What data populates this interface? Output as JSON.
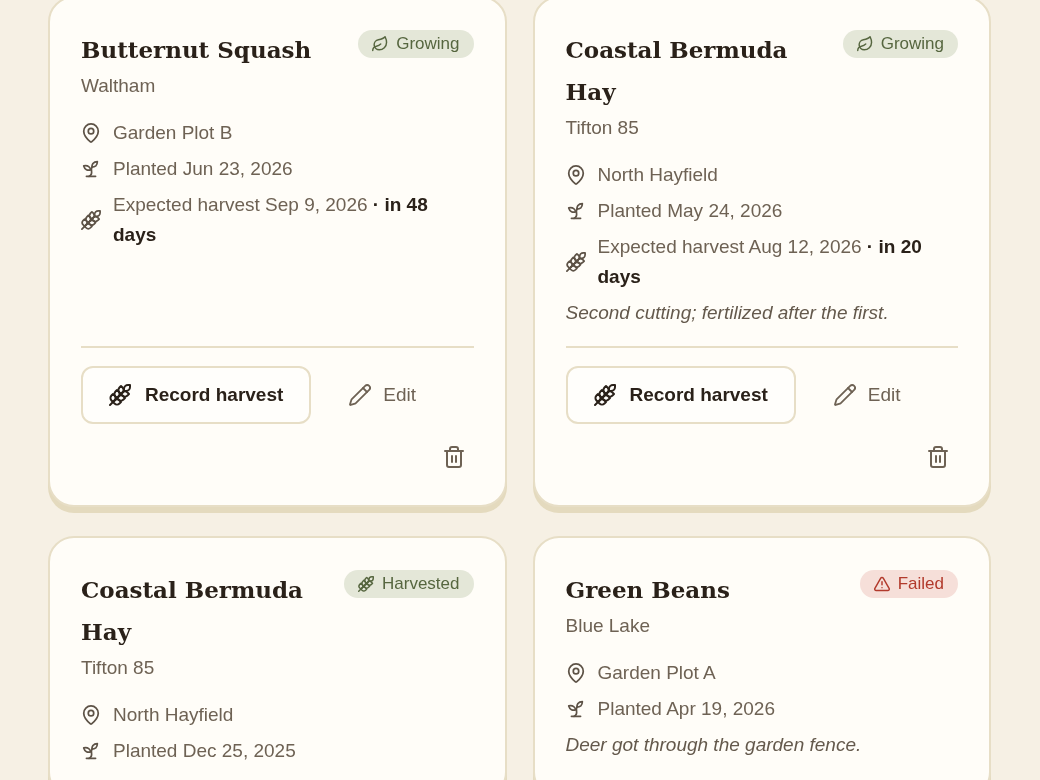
{
  "crops": [
    {
      "name": "Butternut Squash",
      "variety": "Waltham",
      "status": {
        "kind": "growing",
        "label": "Growing"
      },
      "details": [
        {
          "kind": "location",
          "text": "Garden Plot B"
        },
        {
          "kind": "planted",
          "text": "Planted Jun 23, 2026"
        },
        {
          "kind": "harvest",
          "text": "Expected harvest Sep 9, 2026 **· in 48 days**"
        }
      ],
      "actions": [
        {
          "kind": "record",
          "label": "Record harvest"
        },
        {
          "kind": "edit",
          "label": "Edit"
        },
        {
          "kind": "delete"
        }
      ]
    },
    {
      "name": "Coastal Bermuda Hay",
      "variety": "Tifton 85",
      "status": {
        "kind": "growing",
        "label": "Growing"
      },
      "details": [
        {
          "kind": "location",
          "text": "North Hayfield"
        },
        {
          "kind": "planted",
          "text": "Planted May 24, 2026"
        },
        {
          "kind": "harvest",
          "text": "Expected harvest Aug 12, 2026 **· in 20 days**"
        }
      ],
      "notes": "Second cutting; fertilized after the first.",
      "actions": [
        {
          "kind": "record",
          "label": "Record harvest"
        },
        {
          "kind": "edit",
          "label": "Edit"
        },
        {
          "kind": "delete"
        }
      ]
    },
    {
      "name": "Coastal Bermuda Hay",
      "variety": "Tifton 85",
      "status": {
        "kind": "harvested",
        "label": "Harvested"
      },
      "details": [
        {
          "kind": "location",
          "text": "North Hayfield"
        },
        {
          "kind": "planted",
          "text": "Planted Dec 25, 2025"
        }
      ]
    },
    {
      "name": "Green Beans",
      "variety": "Blue Lake",
      "status": {
        "kind": "failed",
        "label": "Failed"
      },
      "details": [
        {
          "kind": "location",
          "text": "Garden Plot A"
        },
        {
          "kind": "planted",
          "text": "Planted Apr 19, 2026"
        }
      ],
      "notes": "Deer got through the garden fence."
    }
  ]
}
